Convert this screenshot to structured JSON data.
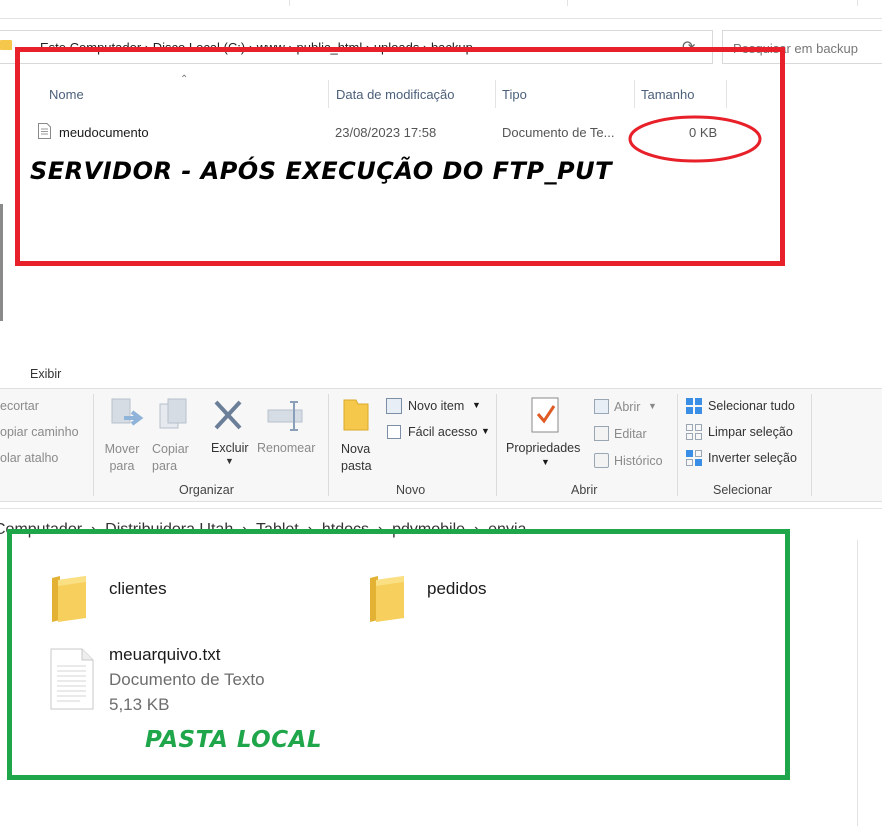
{
  "top_window": {
    "address_crumbs": [
      "Este Computador",
      "Disco Local (C:)",
      "www",
      "public_html",
      "uploads",
      "backup"
    ],
    "search_placeholder": "Pesquisar em backup",
    "columns": [
      "Nome",
      "Data de modificação",
      "Tipo",
      "Tamanho"
    ],
    "file": {
      "name": "meudocumento",
      "date": "23/08/2023 17:58",
      "type": "Documento de Te...",
      "size": "0 KB"
    },
    "annotation": "SERVIDOR - APÓS EXECUÇÃO DO FTP_PUT"
  },
  "ribbon": {
    "tab": "Exibir",
    "clipboard_items": [
      "ecortar",
      "opiar caminho",
      "olar atalho"
    ],
    "organize": {
      "move": "Mover para",
      "copy": "Copiar para",
      "delete": "Excluir",
      "rename": "Renomear",
      "group": "Organizar"
    },
    "new": {
      "folder": "Nova pasta",
      "new_item": "Novo item",
      "easy_access": "Fácil acesso",
      "group": "Novo"
    },
    "open": {
      "properties": "Propriedades",
      "open": "Abrir",
      "edit": "Editar",
      "history": "Histórico",
      "group": "Abrir"
    },
    "select": {
      "all": "Selecionar tudo",
      "none": "Limpar seleção",
      "invert": "Inverter seleção",
      "group": "Selecionar"
    }
  },
  "bottom_window": {
    "address_crumbs": [
      "Computador",
      "Distribuidora Utah",
      "Tablet",
      "htdocs",
      "pdvmobile",
      "envia"
    ],
    "folders": [
      "clientes",
      "pedidos"
    ],
    "file": {
      "name": "meuarquivo.txt",
      "type": "Documento de Texto",
      "size": "5,13 KB"
    },
    "annotation": "PASTA LOCAL"
  },
  "colors": {
    "red_box": "#e8202a",
    "green_box": "#1fa64a",
    "folder": "#f5c84b",
    "annot_text": "#000000",
    "annot_green": "#1fa64a"
  }
}
